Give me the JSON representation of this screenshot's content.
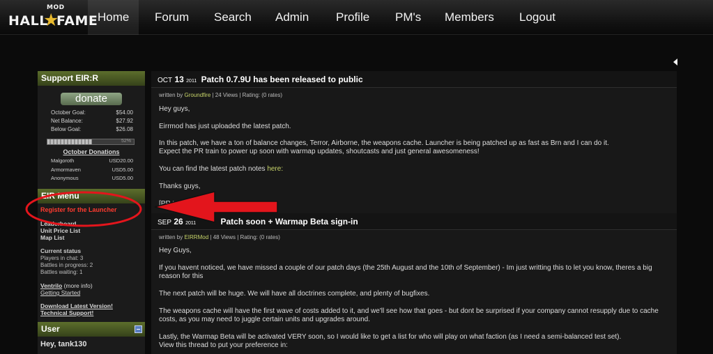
{
  "header": {
    "logo": {
      "top": "MOD",
      "left": "HALL",
      "right": "FAME",
      "star": "★"
    },
    "nav": [
      "Home",
      "Forum",
      "Search",
      "Admin",
      "Profile",
      "PM's",
      "Members",
      "Logout"
    ]
  },
  "sidebar": {
    "support": {
      "title": "Support EIR:R",
      "donate_label": "donate",
      "goals": [
        {
          "label": "October Goal:",
          "value": "$54.00"
        },
        {
          "label": "Net Balance:",
          "value": "$27.92"
        },
        {
          "label": "Below Goal:",
          "value": "$26.08"
        }
      ],
      "progress_percent": 52,
      "progress_label": "52%",
      "donations_title": "October Donations",
      "donors": [
        {
          "name": "Malgoroth",
          "amount": "USD20.00"
        },
        {
          "name": "Armormaven",
          "amount": "USD5.00"
        },
        {
          "name": "Anonymous",
          "amount": "USD5.00"
        }
      ]
    },
    "menu": {
      "title": "EIR Menu",
      "links": [
        "Register for the Launcher",
        "Leaderboard",
        "Unit Price List",
        "Map List"
      ],
      "status_title": "Current status",
      "status_lines": [
        "Players in chat: 3",
        "Battles in progress: 2",
        "Battles waiting: 1"
      ],
      "ventrilo": "Ventrilo",
      "ventrilo_more": "(more info)",
      "getting_started": "Getting Started",
      "download": "Download Latest Version!",
      "support": "Technical Support!"
    },
    "user": {
      "title": "User",
      "greeting": "Hey, tank130"
    }
  },
  "posts": [
    {
      "month": "OCT",
      "day": "13",
      "year": "2011",
      "title": "Patch 0.7.9U has been released to public",
      "meta_prefix": "written by",
      "author": "Groundfire",
      "meta_suffix": "| 24 Views | Rating: (0 rates)",
      "paragraphs": [
        "Hey guys,",
        "Eirrmod has just uploaded the latest patch.",
        "In this patch, we have a ton of balance changes, Terror, Airborne, the weapons cache. Launcher is being patched up as fast as Brn and I can do it.",
        "Expect the PR train to power up soon with warmap updates, shoutcasts and just general awesomeness!",
        "You can find the latest patch notes",
        "here:",
        "Thanks guys,",
        "[PR te"
      ]
    },
    {
      "month": "SEP",
      "day": "26",
      "year": "2011",
      "title": "Patch soon + Warmap Beta sign-in",
      "meta_prefix": "written by",
      "author": "EIRRMod",
      "meta_suffix": "| 48 Views | Rating: (0 rates)",
      "paragraphs": [
        "Hey Guys,",
        "If you havent noticed, we have missed a couple of our patch days (the 25th August and the 10th of September) - Im just writting this to let you know, theres a big",
        "reason for this",
        "The next patch will be huge.   We will have all doctrines complete, and plenty of bugfixes.",
        "The weapons cache will have the first wave of costs added to it, and we'll see how that goes - but dont be surprised if your company cannot resupply due to cache",
        "costs, as you may need to juggle certain units and upgrades around.",
        "Lastly, the Warmap Beta will be activated VERY soon, so I would like to get a list for who will play on what faction (as I need a semi-balanced test set).",
        "View this thread to put your preference in:"
      ]
    }
  ],
  "colors": {
    "annotation_red": "#e3151c",
    "accent_green": "#c8d56a",
    "sidebar_header": "#4a5a24"
  }
}
